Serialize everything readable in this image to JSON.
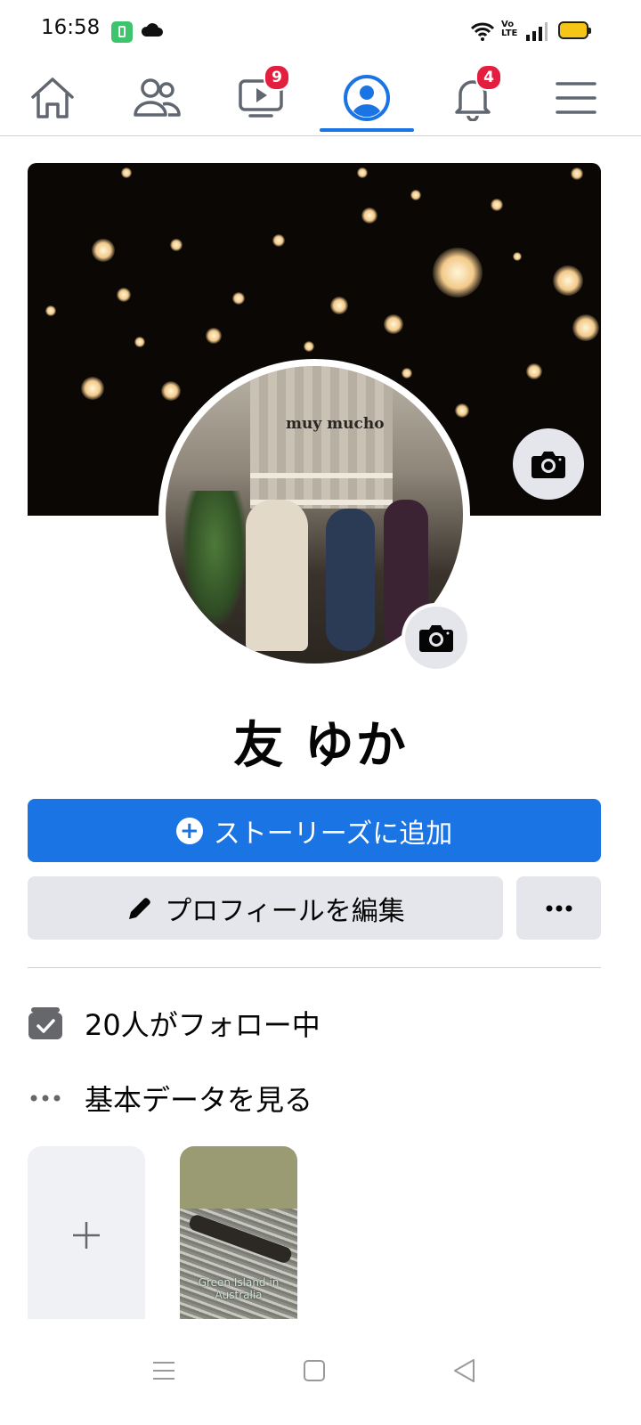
{
  "status_bar": {
    "time": "16:58",
    "network_label": "Vo\nLTE",
    "icons": [
      "battery-saver-icon",
      "cloud-icon",
      "wifi-icon",
      "volte-icon",
      "signal-icon",
      "battery-icon"
    ]
  },
  "tabs": [
    {
      "name": "home",
      "icon": "home-icon",
      "active": false
    },
    {
      "name": "friends",
      "icon": "friends-icon",
      "active": false
    },
    {
      "name": "watch",
      "icon": "video-icon",
      "active": false,
      "badge": "9"
    },
    {
      "name": "profile",
      "icon": "profile-icon",
      "active": true
    },
    {
      "name": "notifications",
      "icon": "bell-icon",
      "active": false,
      "badge": "4"
    },
    {
      "name": "menu",
      "icon": "menu-icon",
      "active": false
    }
  ],
  "profile": {
    "avatar_sign_text": "muy mucho",
    "name": "友 ゆか"
  },
  "actions": {
    "add_story_label": "ストーリーズに追加",
    "edit_profile_label": "プロフィールを編集",
    "more_label": "•••"
  },
  "info": {
    "following": "20人がフォロー中",
    "see_about": "基本データを見る"
  },
  "stories": {
    "add_icon": "plus-icon",
    "card_caption": "Green Island in Australia"
  },
  "colors": {
    "accent": "#1b74e4",
    "badge": "#e41e3f",
    "button_gray": "#e4e6eb"
  }
}
